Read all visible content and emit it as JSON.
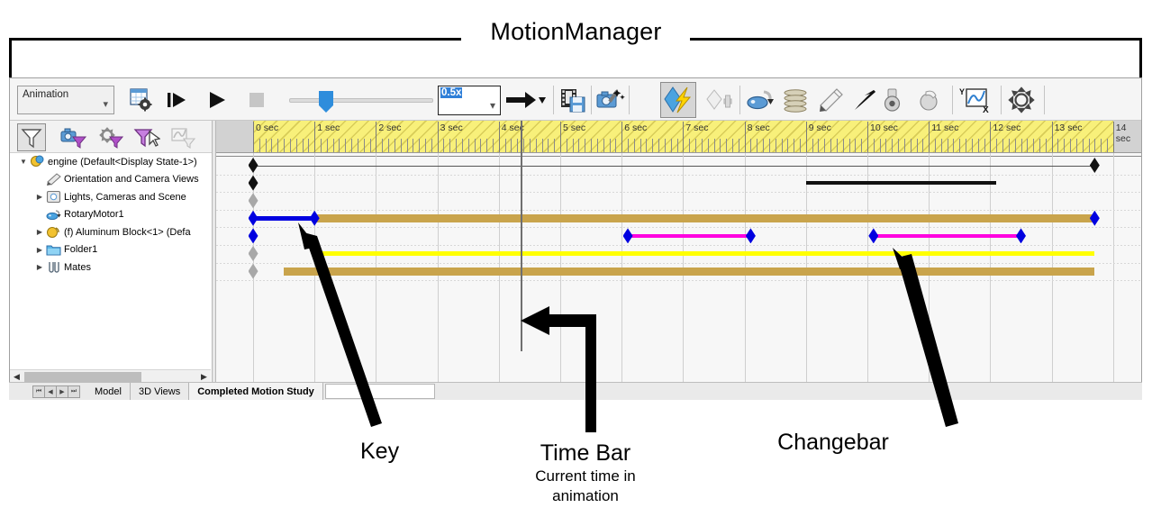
{
  "callout": {
    "title": "MotionManager"
  },
  "toolbar": {
    "study_type": "Animation",
    "speed_value": "0.5x",
    "buttons": [
      {
        "name": "calculate",
        "label": "Calculate"
      },
      {
        "name": "play-from-start",
        "label": "Play from Start"
      },
      {
        "name": "play",
        "label": "Play"
      },
      {
        "name": "stop",
        "label": "Stop"
      },
      {
        "name": "playback-mode",
        "label": "Playback Mode: Normal"
      },
      {
        "name": "save-animation",
        "label": "Save Animation"
      },
      {
        "name": "animation-wizard",
        "label": "Animation Wizard"
      },
      {
        "name": "motor",
        "label": "Motor"
      },
      {
        "name": "spring",
        "label": "Spring"
      },
      {
        "name": "damper",
        "label": "Damper"
      },
      {
        "name": "force",
        "label": "Force"
      },
      {
        "name": "contact",
        "label": "Contact"
      },
      {
        "name": "gravity",
        "label": "Gravity"
      },
      {
        "name": "results-and-plots",
        "label": "Results and Plots"
      },
      {
        "name": "motion-study-properties",
        "label": "Motion Study Properties"
      }
    ]
  },
  "filter_bar": {
    "buttons": [
      {
        "name": "no-filter",
        "label": "No Filter"
      },
      {
        "name": "filter-animated",
        "label": "Filter Animated"
      },
      {
        "name": "filter-driving",
        "label": "Filter Driving"
      },
      {
        "name": "filter-selected",
        "label": "Filter Selected"
      },
      {
        "name": "filter-results",
        "label": "Filter Results"
      }
    ]
  },
  "tree": {
    "items": [
      {
        "label": "engine  (Default<Display State-1>)",
        "icon": "assembly-icon",
        "twisty": "▼",
        "indent": 0
      },
      {
        "label": "Orientation and Camera Views",
        "icon": "camera-views-icon",
        "twisty": "",
        "indent": 1
      },
      {
        "label": "Lights, Cameras and Scene",
        "icon": "lights-icon",
        "twisty": "▶",
        "indent": 1
      },
      {
        "label": "RotaryMotor1",
        "icon": "rotary-motor-icon",
        "twisty": "",
        "indent": 1
      },
      {
        "label": "(f) Aluminum Block<1>  (Defa",
        "icon": "part-icon",
        "twisty": "▶",
        "indent": 1
      },
      {
        "label": "Folder1",
        "icon": "folder-icon",
        "twisty": "▶",
        "indent": 1
      },
      {
        "label": "Mates",
        "icon": "mates-icon",
        "twisty": "▶",
        "indent": 1
      }
    ]
  },
  "timeline": {
    "ruler_labels": [
      "0 sec",
      "1 sec",
      "2 sec",
      "3 sec",
      "4 sec",
      "5 sec",
      "6 sec",
      "7 sec",
      "8 sec",
      "9 sec",
      "10 sec",
      "11 sec",
      "12 sec",
      "13 sec",
      "14 sec"
    ],
    "time_bar_seconds": 4.35,
    "seconds_per_label": 1,
    "colors": {
      "changebar_tan": "#c9a44c",
      "changebar_blue": "#0000e0",
      "changebar_yellow": "#ffff00",
      "changebar_magenta": "#ff00e0",
      "changebar_black": "#111111",
      "key_gray": "#a8a8a8",
      "ruler_yellow": "#f8f07a",
      "timebar_gray": "#6f6f6f"
    },
    "rows": [
      {
        "name": "engine",
        "keys": [
          {
            "t": 0.0,
            "color": "black"
          },
          {
            "t": 13.7,
            "color": "black"
          }
        ],
        "bars": [
          {
            "type": "rule",
            "from": 0.0,
            "to": 13.7
          }
        ]
      },
      {
        "name": "Orientation and Camera Views",
        "keys": [
          {
            "t": 0.0,
            "color": "black"
          }
        ],
        "bars": [
          {
            "type": "black",
            "from": 9.0,
            "to": 12.1
          }
        ]
      },
      {
        "name": "Lights, Cameras and Scene",
        "keys": [
          {
            "t": 0.0,
            "color": "gray"
          }
        ],
        "bars": []
      },
      {
        "name": "RotaryMotor1",
        "keys": [
          {
            "t": 0.0,
            "color": "blue"
          },
          {
            "t": 1.0,
            "color": "blue"
          },
          {
            "t": 13.7,
            "color": "blue"
          }
        ],
        "bars": [
          {
            "type": "blue",
            "from": 0.0,
            "to": 13.7
          },
          {
            "type": "tan",
            "from": 1.0,
            "to": 13.7
          }
        ]
      },
      {
        "name": "(f) Aluminum Block<1>",
        "keys": [
          {
            "t": 0.0,
            "color": "blue"
          },
          {
            "t": 6.1,
            "color": "blue"
          },
          {
            "t": 8.1,
            "color": "blue"
          },
          {
            "t": 10.1,
            "color": "blue"
          },
          {
            "t": 12.5,
            "color": "blue"
          }
        ],
        "bars": [
          {
            "type": "magenta",
            "from": 6.1,
            "to": 8.1
          },
          {
            "type": "magenta",
            "from": 10.1,
            "to": 12.5
          }
        ]
      },
      {
        "name": "Folder1",
        "keys": [
          {
            "t": 0.0,
            "color": "gray"
          }
        ],
        "bars": [
          {
            "type": "yellow",
            "from": 1.0,
            "to": 13.7
          }
        ]
      },
      {
        "name": "Mates",
        "keys": [
          {
            "t": 0.0,
            "color": "gray"
          }
        ],
        "bars": [
          {
            "type": "tan",
            "from": 0.5,
            "to": 13.7
          }
        ]
      }
    ]
  },
  "tab_strip": {
    "nav_buttons": [
      "⏮",
      "◀",
      "▶",
      "⏭"
    ],
    "tabs": [
      {
        "label": "Model",
        "active": false
      },
      {
        "label": "3D Views",
        "active": false
      },
      {
        "label": "Completed Motion Study",
        "active": true
      }
    ]
  },
  "annotations": [
    {
      "name": "key",
      "title": "Key",
      "subtitle": ""
    },
    {
      "name": "time-bar",
      "title": "Time Bar",
      "subtitle": "Current time in\nanimation"
    },
    {
      "name": "changebar",
      "title": "Changebar",
      "subtitle": ""
    }
  ]
}
